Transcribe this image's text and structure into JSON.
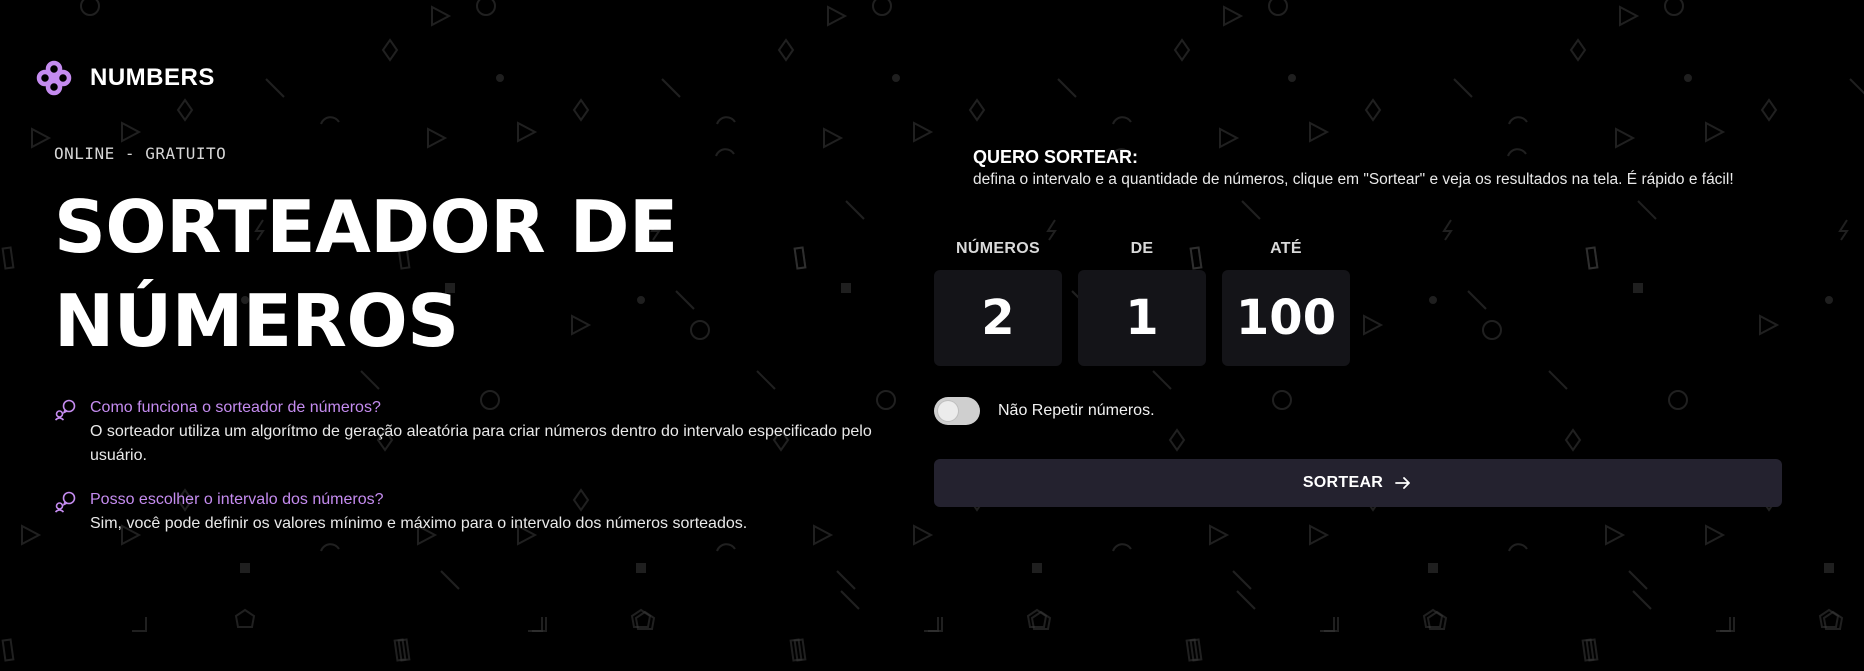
{
  "brand": {
    "name": "NUMBERS",
    "icon": "flower-logo-icon",
    "accent": "#c58cf0"
  },
  "hero": {
    "eyebrow": "ONLINE - GRATUITO",
    "title_line1": "SORTEADOR DE",
    "title_line2": "NÚMEROS"
  },
  "faq": [
    {
      "icon": "chat-bubbles-icon",
      "question": "Como funciona o sorteador de números?",
      "answer": "O sorteador utiliza um algorítmo de geração aleatória para criar números dentro do intervalo especificado pelo usuário."
    },
    {
      "icon": "chat-bubbles-icon",
      "question": "Posso escolher o intervalo dos números?",
      "answer": "Sim, você pode definir os valores mínimo e máximo para o intervalo dos números sorteados."
    }
  ],
  "draw": {
    "title": "QUERO SORTEAR:",
    "description": "defina o intervalo e a quantidade de números, clique em \"Sortear\" e veja os resultados na tela. É rápido e fácil!",
    "fields": {
      "quantity": {
        "label": "NÚMEROS",
        "value": "2"
      },
      "min": {
        "label": "DE",
        "value": "1"
      },
      "max": {
        "label": "ATÉ",
        "value": "100"
      }
    },
    "no_repeat": {
      "label": "Não Repetir números.",
      "checked": false
    },
    "button": {
      "label": "SORTEAR",
      "icon": "arrow-right-icon"
    }
  },
  "colors": {
    "background": "#000000",
    "field_bg": "#141418",
    "button_bg": "#24222f",
    "pattern": "#3a3a3a"
  }
}
